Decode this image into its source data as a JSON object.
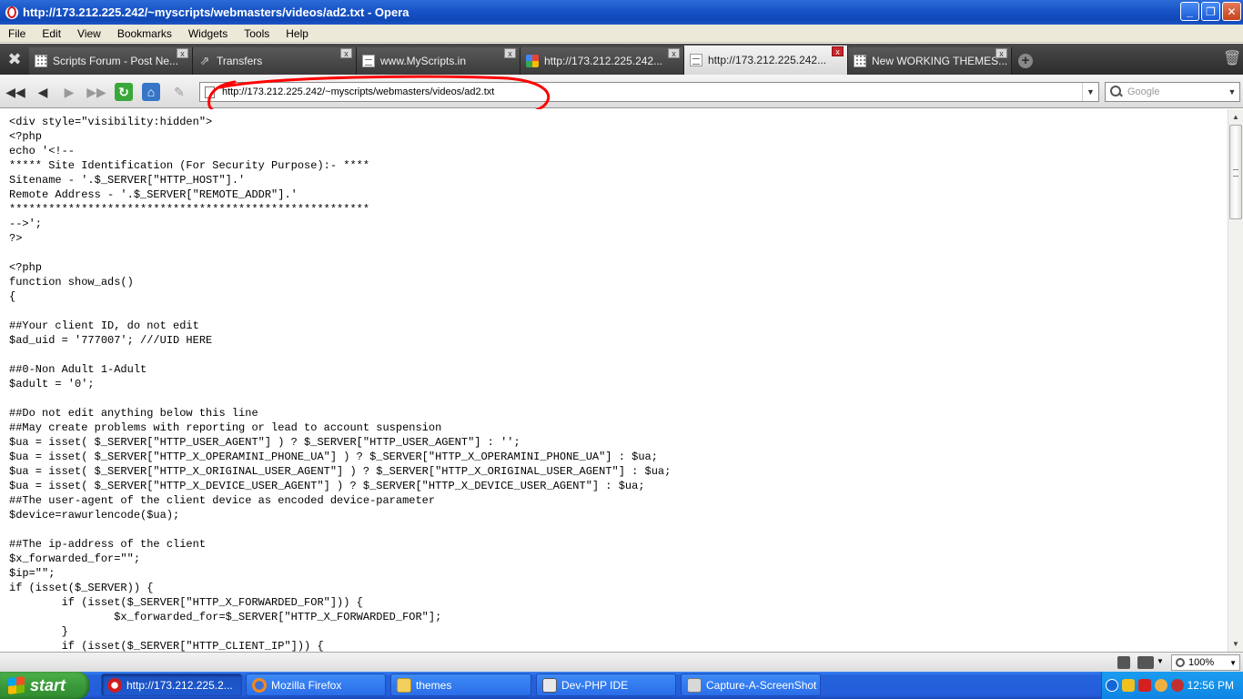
{
  "window": {
    "title": "http://173.212.225.242/~myscripts/webmasters/videos/ad2.txt - Opera"
  },
  "menu": [
    "File",
    "Edit",
    "View",
    "Bookmarks",
    "Widgets",
    "Tools",
    "Help"
  ],
  "tabs": [
    {
      "label": "Scripts Forum - Post Ne...",
      "icon": "grid-favicon-icon"
    },
    {
      "label": "Transfers",
      "icon": "transfers-icon"
    },
    {
      "label": "www.MyScripts.in",
      "icon": "page-icon"
    },
    {
      "label": "http://173.212.225.242...",
      "icon": "google-favicon-icon"
    },
    {
      "label": "http://173.212.225.242...",
      "icon": "page-icon",
      "active": true
    },
    {
      "label": "New WORKING THEMES...",
      "icon": "grid-favicon-icon"
    }
  ],
  "address": {
    "url": "http://173.212.225.242/~myscripts/webmasters/videos/ad2.txt"
  },
  "search": {
    "placeholder": "Google"
  },
  "annotation": {
    "color": "#ff0000"
  },
  "content": {
    "lines": [
      "<div style=\"visibility:hidden\">",
      "<?php",
      "echo '<!--",
      "***** Site Identification (For Security Purpose):- ****",
      "Sitename - '.$_SERVER[\"HTTP_HOST\"].'",
      "Remote Address - '.$_SERVER[\"REMOTE_ADDR\"].'",
      "*******************************************************",
      "-->';",
      "?>",
      "",
      "<?php",
      "function show_ads()",
      "{",
      "",
      "##Your client ID, do not edit",
      "$ad_uid = '777007'; ///UID HERE",
      "",
      "##0-Non Adult 1-Adult",
      "$adult = '0';",
      "",
      "##Do not edit anything below this line",
      "##May create problems with reporting or lead to account suspension",
      "$ua = isset( $_SERVER[\"HTTP_USER_AGENT\"] ) ? $_SERVER[\"HTTP_USER_AGENT\"] : '';",
      "$ua = isset( $_SERVER[\"HTTP_X_OPERAMINI_PHONE_UA\"] ) ? $_SERVER[\"HTTP_X_OPERAMINI_PHONE_UA\"] : $ua;",
      "$ua = isset( $_SERVER[\"HTTP_X_ORIGINAL_USER_AGENT\"] ) ? $_SERVER[\"HTTP_X_ORIGINAL_USER_AGENT\"] : $ua;",
      "$ua = isset( $_SERVER[\"HTTP_X_DEVICE_USER_AGENT\"] ) ? $_SERVER[\"HTTP_X_DEVICE_USER_AGENT\"] : $ua;",
      "##The user-agent of the client device as encoded device-parameter",
      "$device=rawurlencode($ua);",
      "",
      "##The ip-address of the client",
      "$x_forwarded_for=\"\";",
      "$ip=\"\";",
      "if (isset($_SERVER)) {",
      "        if (isset($_SERVER[\"HTTP_X_FORWARDED_FOR\"])) {",
      "                $x_forwarded_for=$_SERVER[\"HTTP_X_FORWARDED_FOR\"];",
      "        }",
      "        if (isset($_SERVER[\"HTTP_CLIENT_IP\"])) {"
    ]
  },
  "status": {
    "zoom": "100%"
  },
  "taskbar": {
    "start_label": "start",
    "tasks": [
      {
        "label": "http://173.212.225.2...",
        "icon": "opera-icon",
        "active": true
      },
      {
        "label": "Mozilla Firefox",
        "icon": "firefox-icon"
      },
      {
        "label": "themes",
        "icon": "folder-icon"
      },
      {
        "label": "Dev-PHP IDE",
        "icon": "ide-icon"
      },
      {
        "label": "Capture-A-ScreenShot",
        "icon": "capture-icon"
      }
    ],
    "clock": "12:56 PM"
  }
}
